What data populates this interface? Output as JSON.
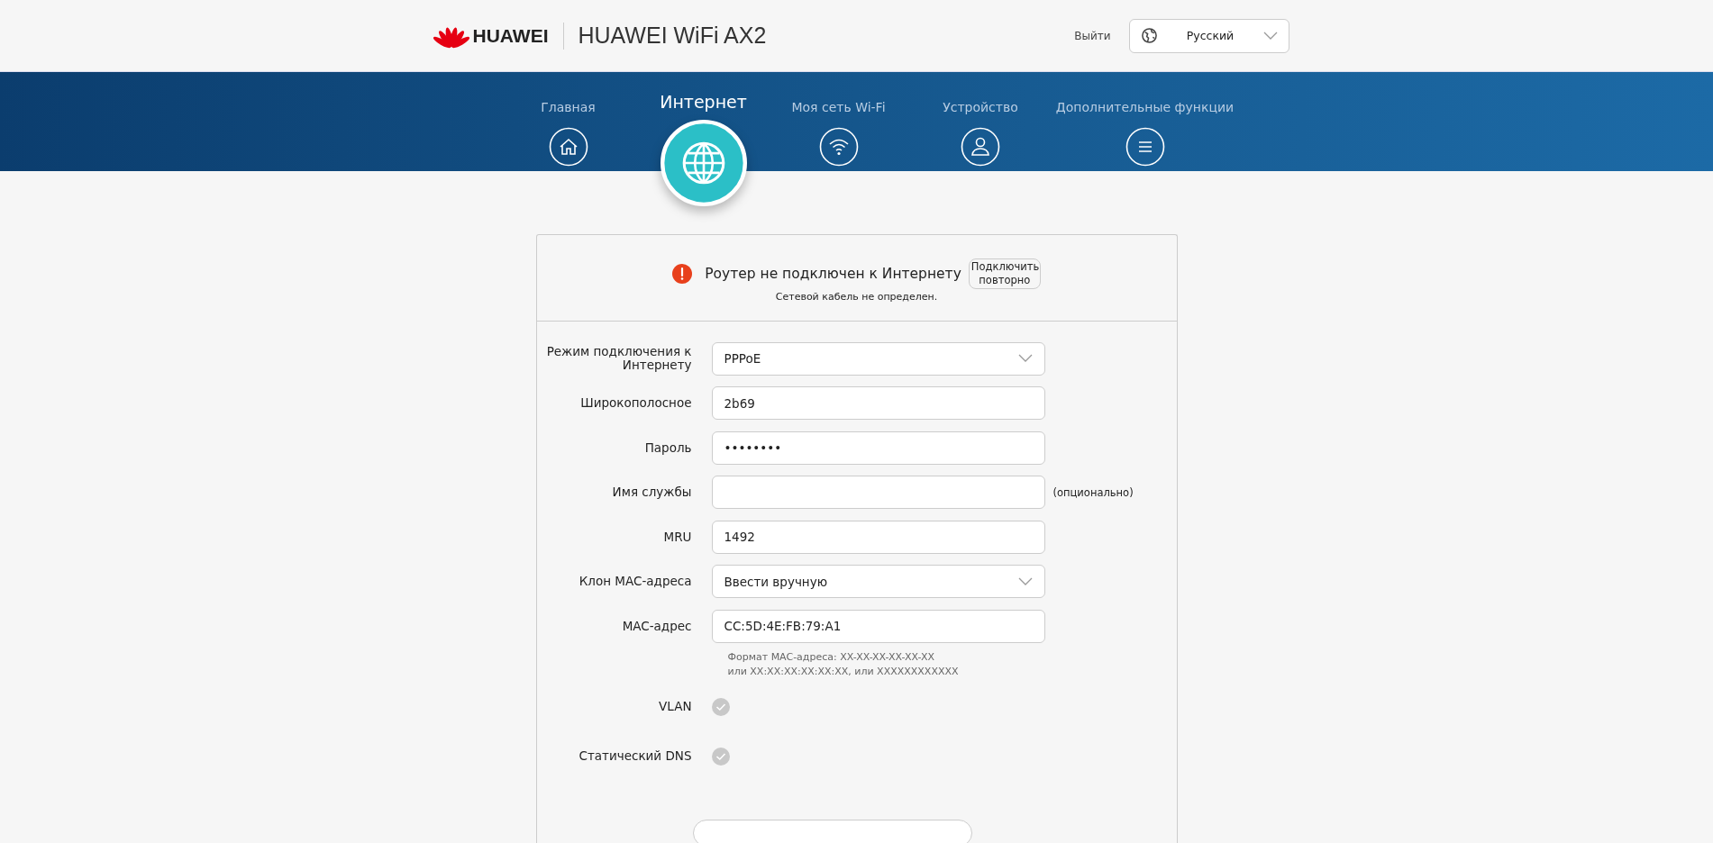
{
  "header": {
    "brand": "HUAWEI",
    "product": "HUAWEI WiFi AX2",
    "logout": "Выйти",
    "language": "Русский"
  },
  "tabs": [
    {
      "label": "Главная",
      "selected": false
    },
    {
      "label": "Интернет",
      "selected": true
    },
    {
      "label": "Моя сеть Wi-Fi",
      "selected": false
    },
    {
      "label": "Устройство",
      "selected": false
    },
    {
      "label": "Дополнительные функции",
      "selected": false
    }
  ],
  "status": {
    "message": "Роутер не подключен к Интернету",
    "button": "Подключить повторно",
    "detail": "Сетевой кабель не определен."
  },
  "form": [
    {
      "kind": "select",
      "label": "Режим подключения к Интернету",
      "value": "PPPoE"
    },
    {
      "kind": "text",
      "label": "Широкополосное",
      "value": "2b69"
    },
    {
      "kind": "text",
      "label": "Пароль",
      "value": "••••••••"
    },
    {
      "kind": "text",
      "label": "Имя службы",
      "note": "(опционально)"
    },
    {
      "kind": "text",
      "label": "MRU",
      "value": "1492"
    },
    {
      "kind": "select",
      "label": "Клон MAC-адреса",
      "value": "Ввести вручную"
    },
    {
      "kind": "text",
      "label": "MAC-адрес",
      "value": "CC:5D:4E:FB:79:A1",
      "hint": [
        "Формат MAC-адреса: XX-XX-XX-XX-XX-XX",
        "или XX:XX:XX:XX:XX:XX, или XXXXXXXXXXXX"
      ]
    },
    {
      "kind": "check",
      "label": "VLAN",
      "checked": false
    },
    {
      "kind": "check",
      "label": "Статический DNS",
      "checked": false
    }
  ]
}
